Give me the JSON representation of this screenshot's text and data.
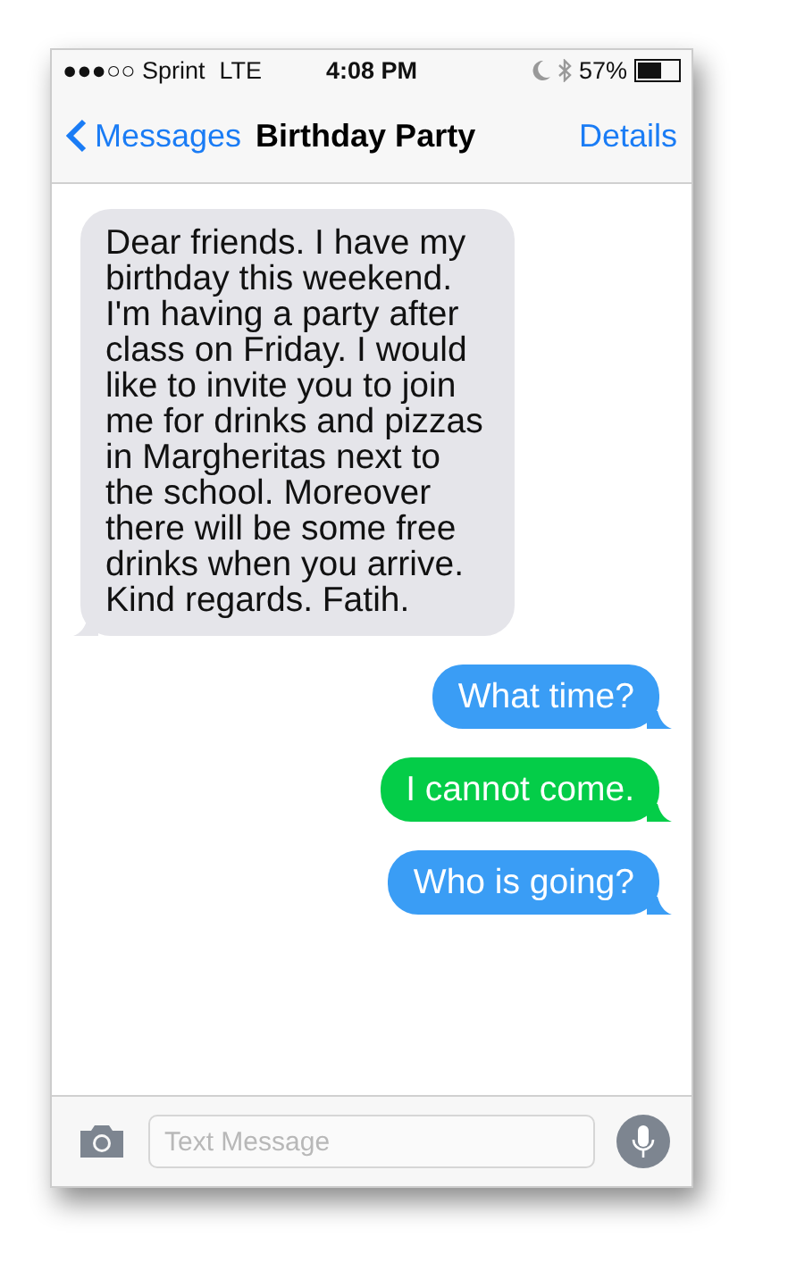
{
  "status_bar": {
    "carrier": "●●●○○ Sprint",
    "network": "LTE",
    "time": "4:08 PM",
    "battery": "57%"
  },
  "nav": {
    "back": "Messages",
    "title": "Birthday Party",
    "action": "Details"
  },
  "messages": [
    {
      "kind": "incoming",
      "color": "#e5e5ea",
      "text": "Dear friends. I have my birthday this weekend. I'm having a party after class on Friday. I would like to invite you to join me for drinks and pizzas in Margheritas next to the school. Moreover there will be some free drinks when you arrive. Kind regards. Fatih."
    },
    {
      "kind": "outgoing",
      "color": "#3a9df5",
      "text": "What time?"
    },
    {
      "kind": "outgoing",
      "color": "#04cd48",
      "text": "I cannot come."
    },
    {
      "kind": "outgoing",
      "color": "#3a9df5",
      "text": "Who is going?"
    }
  ],
  "composer": {
    "placeholder": "Text Message"
  }
}
